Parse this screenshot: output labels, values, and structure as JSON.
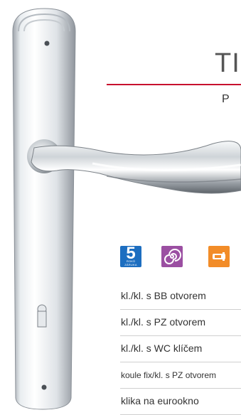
{
  "product": {
    "title": "TI",
    "subtitle": "P"
  },
  "badges": [
    {
      "name": "warranty",
      "number": "5",
      "caption": "ROKŮ ZÁRUKA",
      "color": "#1d6ec0"
    },
    {
      "name": "spiral",
      "color": "#9b4fa2"
    },
    {
      "name": "lock",
      "color": "#f28c28"
    }
  ],
  "variants": [
    "kl./kl. s BB otvorem",
    "kl./kl. s PZ otvorem",
    "kl./kl. s WC klíčem",
    "koule fix/kl. s PZ otvorem",
    "klika na eurookno"
  ],
  "colors": {
    "accent_rule": "#c8102e"
  }
}
